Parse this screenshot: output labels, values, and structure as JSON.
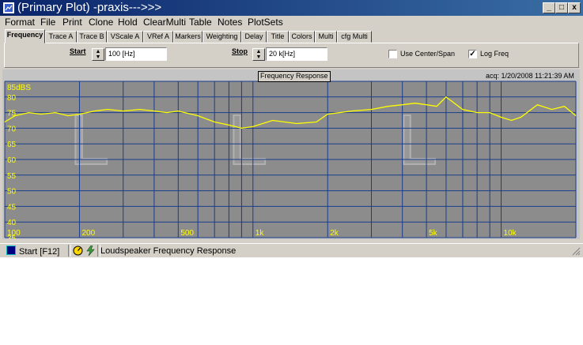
{
  "window": {
    "title": "(Primary Plot) -praxis--->>>",
    "controls": [
      "_",
      "□",
      "x"
    ]
  },
  "menu": [
    "Format",
    "File",
    "Print",
    "Clone",
    "Hold",
    "ClearMulti",
    "Table",
    "Notes",
    "PlotSets"
  ],
  "tabs": [
    "Frequency",
    "Trace A",
    "Trace B",
    "VScale A",
    "VRef A",
    "Markers",
    "Weighting",
    "Delay",
    "Title",
    "Colors",
    "Multi",
    "cfg Multi"
  ],
  "active_tab": "Frequency",
  "controls": {
    "start_label": "Start",
    "start_value": "100 [Hz]",
    "stop_label": "Stop",
    "stop_value": "20 k[Hz]",
    "use_center_span_label": "Use Center/Span",
    "use_center_span_checked": false,
    "log_freq_label": "Log Freq",
    "log_freq_checked": true
  },
  "plot": {
    "title": "Frequency Response",
    "acq": "acq: 1/20/2008 11:21:39 AM",
    "background_color": "#8c8c8c",
    "grid_color": "#1a3c8c",
    "trace_color": "#ffff00",
    "label_color": "#ffff00"
  },
  "chart_data": {
    "type": "line",
    "title": "Frequency Response",
    "xscale": "log",
    "xlim": [
      100,
      20000
    ],
    "ylim": [
      35,
      85
    ],
    "ytick_labels": [
      "85dBS",
      "80",
      "75",
      "70",
      "65",
      "60",
      "55",
      "50",
      "45",
      "40",
      "35"
    ],
    "xtick_labels": [
      "100",
      "200",
      "500",
      "1k",
      "2k",
      "5k",
      "10k"
    ],
    "series": [
      {
        "x": [
          100,
          110,
          125,
          140,
          160,
          180,
          200,
          230,
          260,
          300,
          350,
          400,
          450,
          500,
          600,
          700,
          800,
          900,
          1000,
          1200,
          1500,
          1800,
          2000,
          2500,
          3000,
          3500,
          4000,
          4500,
          5000,
          5500,
          6000,
          7000,
          8000,
          9000,
          10000,
          11000,
          12000,
          14000,
          16000,
          18000,
          20000
        ],
        "y": [
          72,
          74,
          75,
          74.5,
          75,
          74,
          74.5,
          75.5,
          76,
          75.5,
          76,
          75.5,
          75,
          75.5,
          74,
          72,
          71,
          70,
          70.5,
          72.5,
          71.5,
          72,
          74.5,
          75.5,
          76,
          77,
          77.5,
          78,
          77.5,
          77,
          80,
          76,
          75,
          75,
          73.5,
          72.5,
          73.5,
          77.5,
          76,
          77,
          74
        ]
      }
    ]
  },
  "status": {
    "start_button": "Start [F12]",
    "text": "Loudspeaker Frequency Response"
  }
}
